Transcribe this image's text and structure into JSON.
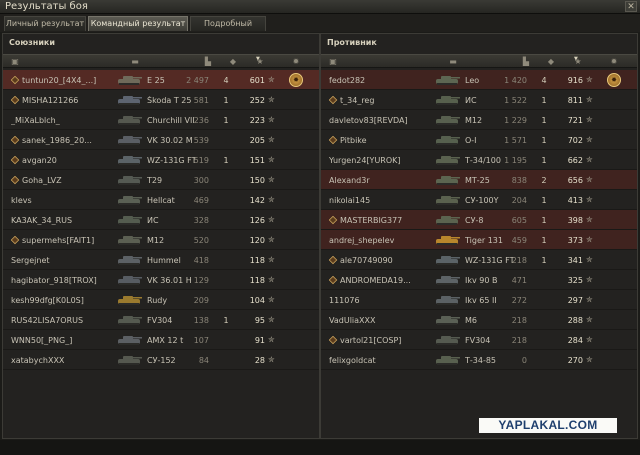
{
  "window": {
    "title": "Результаты боя",
    "close_label": "✕"
  },
  "tabs": [
    {
      "label": "Личный результат"
    },
    {
      "label": "Командный результат",
      "active": true
    },
    {
      "label": "Подробный отчёт"
    }
  ],
  "allies": {
    "title": "Союзники",
    "rows": [
      {
        "player": "tuntun20_[4X4_...]",
        "vehicle": "E 25",
        "damage": "2 497",
        "kills": "4",
        "xp": "601",
        "badge": true,
        "me": true,
        "medal": true,
        "tank_color": "#6f6a5a"
      },
      {
        "player": "MISHA121266",
        "vehicle": "Škoda T 25",
        "damage": "581",
        "kills": "1",
        "xp": "252",
        "badge": true,
        "tank_color": "#5d6470"
      },
      {
        "player": "_MiXaLblch_",
        "vehicle": "Churchill VII",
        "damage": "236",
        "kills": "1",
        "xp": "223",
        "tank_color": "#55584f"
      },
      {
        "player": "sanek_1986_20...",
        "vehicle": "VK 30.02 M",
        "damage": "539",
        "kills": "",
        "xp": "205",
        "badge": true,
        "tank_color": "#5a5e64"
      },
      {
        "player": "avgan20",
        "vehicle": "WZ-131G FT",
        "damage": "519",
        "kills": "1",
        "xp": "151",
        "badge": true,
        "tank_color": "#5b6367"
      },
      {
        "player": "Goha_LVZ",
        "vehicle": "T29",
        "damage": "300",
        "kills": "",
        "xp": "150",
        "badge": true,
        "tank_color": "#555a53"
      },
      {
        "player": "klevs",
        "vehicle": "Hellcat",
        "damage": "469",
        "kills": "",
        "xp": "142",
        "tank_color": "#5a6054"
      },
      {
        "player": "KA3AK_34_RUS",
        "vehicle": "ИС",
        "damage": "328",
        "kills": "",
        "xp": "126",
        "tank_color": "#545c4f"
      },
      {
        "player": "supermehs[FAIT1]",
        "vehicle": "M12",
        "damage": "520",
        "kills": "",
        "xp": "120",
        "badge": true,
        "tank_color": "#5b5f52"
      },
      {
        "player": "Sergejnet",
        "vehicle": "Hummel",
        "damage": "418",
        "kills": "",
        "xp": "118",
        "tank_color": "#5c6165"
      },
      {
        "player": "hagibator_918[TROX]",
        "vehicle": "VK 36.01 H",
        "damage": "129",
        "kills": "",
        "xp": "118",
        "tank_color": "#575c62"
      },
      {
        "player": "kesh99dfg[K0L0S]",
        "vehicle": "Rudy",
        "damage": "209",
        "kills": "",
        "xp": "104",
        "tank_color": "#9a7a2e"
      },
      {
        "player": "RUS42LISA7ORUS",
        "vehicle": "FV304",
        "damage": "138",
        "kills": "1",
        "xp": "95",
        "tank_color": "#555a50"
      },
      {
        "player": "WNN50[_PNG_]",
        "vehicle": "AMX 12 t",
        "damage": "107",
        "kills": "",
        "xp": "91",
        "tank_color": "#5b5f63"
      },
      {
        "player": "xatabychXXX",
        "vehicle": "СУ-152",
        "damage": "84",
        "kills": "",
        "xp": "28",
        "tank_color": "#55584f"
      }
    ]
  },
  "enemies": {
    "title": "Противник",
    "rows": [
      {
        "player": "fedot282",
        "vehicle": "Leo",
        "damage": "1 420",
        "kills": "4",
        "xp": "916",
        "medal": true,
        "top": true,
        "tank_color": "#5d6652"
      },
      {
        "player": "t_34_reg",
        "vehicle": "ИС",
        "damage": "1 522",
        "kills": "1",
        "xp": "811",
        "badge": true,
        "tank_color": "#57604d"
      },
      {
        "player": "davletov83[REVDA]",
        "vehicle": "M12",
        "damage": "1 229",
        "kills": "1",
        "xp": "721",
        "tank_color": "#58604f"
      },
      {
        "player": "Pitbike",
        "vehicle": "О-I",
        "damage": "1 571",
        "kills": "1",
        "xp": "702",
        "badge": true,
        "tank_color": "#56604e"
      },
      {
        "player": "Yurgen24[YUROK]",
        "vehicle": "Т-34/100",
        "damage": "1 195",
        "kills": "1",
        "xp": "662",
        "tank_color": "#5a624f"
      },
      {
        "player": "Alexand3r",
        "vehicle": "МТ-25",
        "damage": "838",
        "kills": "2",
        "xp": "656",
        "top": true,
        "tank_color": "#5c6550"
      },
      {
        "player": "nikolai145",
        "vehicle": "СУ-100Y",
        "damage": "204",
        "kills": "1",
        "xp": "413",
        "tank_color": "#5a614e"
      },
      {
        "player": "MASTERBIG377",
        "vehicle": "СУ-8",
        "damage": "605",
        "kills": "1",
        "xp": "398",
        "badge": true,
        "top": true,
        "tank_color": "#5b634f"
      },
      {
        "player": "andrej_shepelev",
        "vehicle": "Tiger 131",
        "damage": "459",
        "kills": "1",
        "xp": "373",
        "top": true,
        "tank_color": "#b8862c"
      },
      {
        "player": "ale70749090",
        "vehicle": "WZ-131G FT",
        "damage": "218",
        "kills": "1",
        "xp": "341",
        "badge": true,
        "tank_color": "#5b6367"
      },
      {
        "player": "ANDROMEDA19...",
        "vehicle": "Ikv 90 B",
        "damage": "471",
        "kills": "",
        "xp": "325",
        "badge": true,
        "tank_color": "#5d6366"
      },
      {
        "player": "111076",
        "vehicle": "Ikv 65 II",
        "damage": "272",
        "kills": "",
        "xp": "297",
        "tank_color": "#5b6164"
      },
      {
        "player": "VadUliaXXX",
        "vehicle": "M6",
        "damage": "218",
        "kills": "",
        "xp": "288",
        "tank_color": "#5a6055"
      },
      {
        "player": "vartol21[COSP]",
        "vehicle": "FV304",
        "damage": "218",
        "kills": "",
        "xp": "284",
        "badge": true,
        "tank_color": "#555a50"
      },
      {
        "player": "felixgoldcat",
        "vehicle": "Т-34-85",
        "damage": "0",
        "kills": "",
        "xp": "270",
        "tank_color": "#58604f"
      }
    ]
  },
  "column_icons": {
    "platoon": "platoon-icon",
    "vehicle": "tank-icon",
    "damage": "damage-icon",
    "kills": "kills-icon",
    "xp": "xp-star-icon",
    "achievement": "achievement-icon"
  },
  "xp_star_glyph": "✮",
  "medal_glyph": "✸",
  "watermark": "YAPLAKAL.COM",
  "colors": {
    "me_row": "#5a2a22",
    "accent": "#c9a35d",
    "watermark_text": "#1f3f6e"
  }
}
